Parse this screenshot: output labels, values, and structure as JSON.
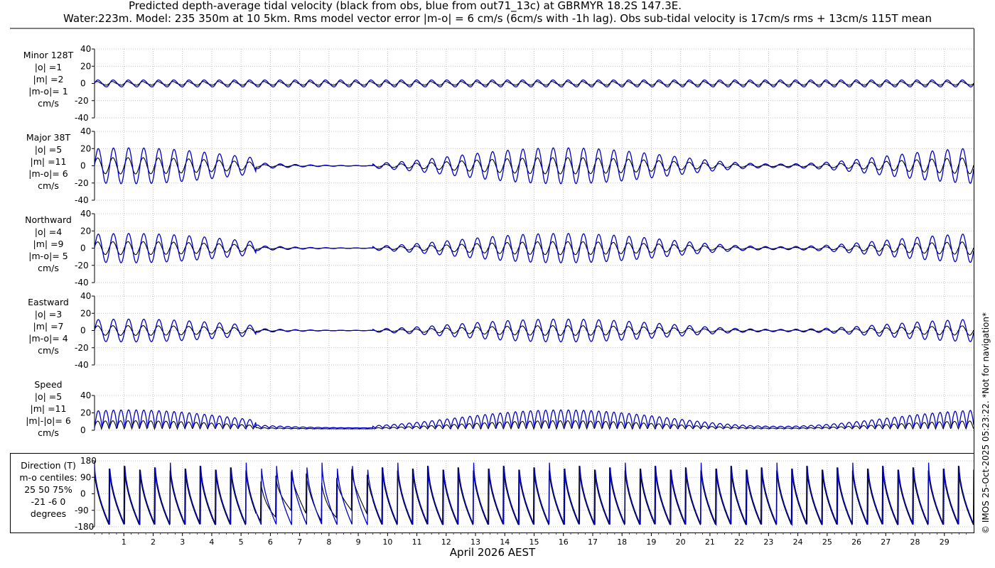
{
  "title_line1": "Predicted depth-average tidal velocity (black from obs, blue from out71_13c) at GBRMYR 18.2S 147.3E.",
  "title_line2": "Water:223m. Model: 235 350m at 10 5km. Rms model vector error |m-o| = 6 cm/s (6cm/s with -1h lag). Obs sub-tidal velocity is 17cm/s rms + 13cm/s 115T mean",
  "side_text": "© IMOS 25-Oct-2025 05:23:22. *Not for navigation*",
  "colors": {
    "obs": "#000000",
    "model": "#0000cc",
    "grid": "#b0b0b0"
  },
  "chart_data": {
    "type": "line",
    "xlabel": "April 2026 AEST",
    "x_ticks": [
      "1",
      "2",
      "3",
      "4",
      "5",
      "6",
      "7",
      "8",
      "9",
      "10",
      "11",
      "12",
      "13",
      "14",
      "15",
      "16",
      "17",
      "18",
      "19",
      "20",
      "21",
      "22",
      "23",
      "24",
      "25",
      "26",
      "27",
      "28",
      "29"
    ],
    "x_range_days": [
      0.0,
      30.0
    ],
    "grid": true,
    "series_legend": {
      "obs": "black",
      "model": "blue"
    },
    "panels": [
      {
        "id": "minor",
        "label": [
          "Minor 128T",
          "|o| =1",
          "|m| =2",
          "|m-o|= 1",
          "cm/s"
        ],
        "yticks": [
          "40",
          "20",
          "0",
          "-20",
          "-40"
        ],
        "ylim": [
          -40,
          40
        ],
        "obs_amp": 1,
        "model_amp": 2
      },
      {
        "id": "major",
        "label": [
          "Major 38T",
          "|o| =5",
          "|m| =11",
          "|m-o|= 6",
          "cm/s"
        ],
        "yticks": [
          "40",
          "20",
          "0",
          "-20",
          "-40"
        ],
        "ylim": [
          -40,
          40
        ],
        "obs_amp": 5,
        "model_amp": 11
      },
      {
        "id": "north",
        "label": [
          "Northward",
          "|o| =4",
          "|m| =9",
          "|m-o|= 5",
          "cm/s"
        ],
        "yticks": [
          "40",
          "20",
          "0",
          "-20",
          "-40"
        ],
        "ylim": [
          -40,
          40
        ],
        "obs_amp": 4,
        "model_amp": 9
      },
      {
        "id": "east",
        "label": [
          "Eastward",
          "|o| =3",
          "|m| =7",
          "|m-o|= 4",
          "cm/s"
        ],
        "yticks": [
          "40",
          "20",
          "0",
          "-20",
          "-40"
        ],
        "ylim": [
          -40,
          40
        ],
        "obs_amp": 3,
        "model_amp": 7
      },
      {
        "id": "speed",
        "label": [
          "Speed",
          "|o| =5",
          "|m| =11",
          "|m|-|o|= 6",
          "cm/s"
        ],
        "yticks": [
          "40",
          "20",
          "0"
        ],
        "ylim": [
          0,
          40
        ],
        "obs_amp": 5,
        "model_amp": 11
      },
      {
        "id": "direction",
        "label": [
          "Direction (T)",
          "m-o centiles:",
          "25  50  75%",
          "-21  -6   0",
          "degrees"
        ],
        "yticks": [
          "180",
          "90",
          "0",
          "-90",
          "-180"
        ],
        "ylim": [
          -180,
          180
        ]
      }
    ]
  }
}
